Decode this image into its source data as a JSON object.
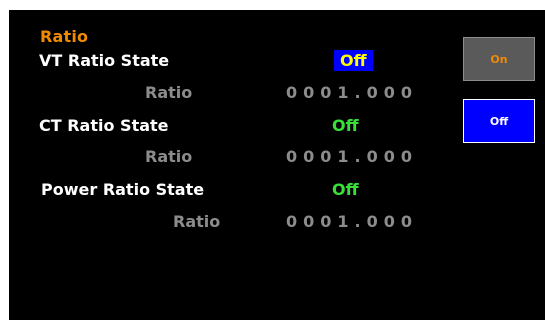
{
  "header": {
    "title": "Ratio"
  },
  "rows": {
    "vt_state": {
      "label": "VT Ratio State",
      "value": "Off",
      "selected": true
    },
    "vt_ratio": {
      "label": "Ratio",
      "value": "0001.000"
    },
    "ct_state": {
      "label": "CT Ratio State",
      "value": "Off",
      "selected": false
    },
    "ct_ratio": {
      "label": "Ratio",
      "value": "0001.000"
    },
    "power_state": {
      "label": "Power Ratio State",
      "value": "Off",
      "selected": false
    },
    "power_ratio": {
      "label": "Ratio",
      "value": "0001.000"
    }
  },
  "softkeys": {
    "on": "On",
    "off": "Off"
  },
  "colors": {
    "background": "#000000",
    "title": "#f08a00",
    "state_value": "#39e039",
    "selected_bg": "#0000ff",
    "selected_text": "#ffff00",
    "dim_text": "#8c8c8c",
    "softkey_on_bg": "#5a5a5a",
    "softkey_off_bg": "#0000ff"
  }
}
